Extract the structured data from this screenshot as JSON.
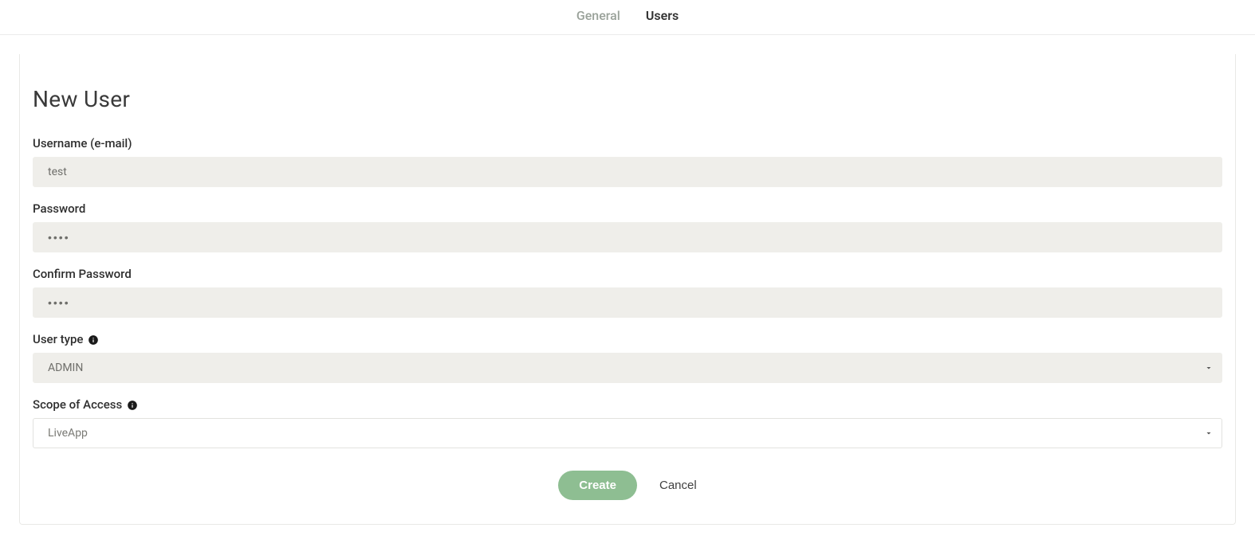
{
  "tabs": {
    "general": "General",
    "users": "Users"
  },
  "page_title": "New User",
  "form": {
    "username_label": "Username (e-mail)",
    "username_value": "test",
    "password_label": "Password",
    "password_value": "••••",
    "confirm_password_label": "Confirm Password",
    "confirm_password_value": "••••",
    "user_type_label": "User type",
    "user_type_value": "ADMIN",
    "scope_label": "Scope of Access",
    "scope_value": "LiveApp"
  },
  "actions": {
    "create": "Create",
    "cancel": "Cancel"
  }
}
